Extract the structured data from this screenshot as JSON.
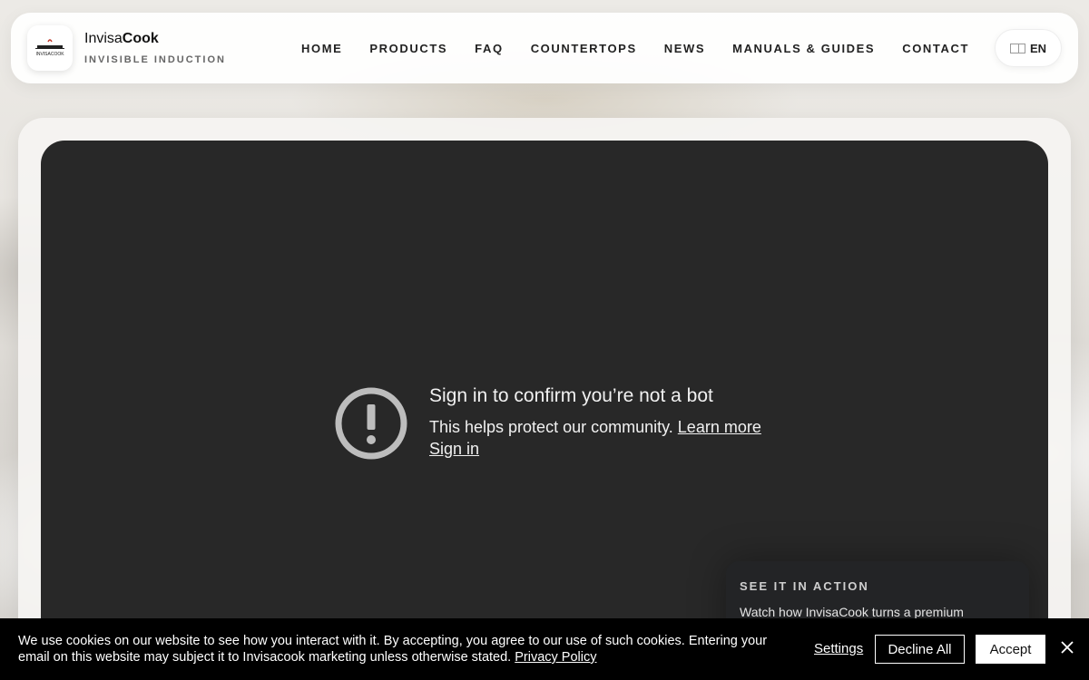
{
  "header": {
    "brand_light": "Invisa",
    "brand_bold": "Cook",
    "tagline": "INVISIBLE INDUCTION",
    "logo_text": "INVISACOOK",
    "nav": [
      {
        "label": "HOME"
      },
      {
        "label": "PRODUCTS"
      },
      {
        "label": "FAQ"
      },
      {
        "label": "COUNTERTOPS"
      },
      {
        "label": "NEWS"
      },
      {
        "label": "MANUALS & GUIDES"
      },
      {
        "label": "CONTACT"
      }
    ],
    "language": "EN",
    "language_icon": "uk-flag-icon"
  },
  "video": {
    "title": "Sign in to confirm you’re not a bot",
    "subtitle": "This helps protect our community.",
    "learn_more": "Learn more",
    "sign_in": "Sign in",
    "icon": "exclamation-circle-icon"
  },
  "action_box": {
    "title": "SEE IT IN ACTION",
    "text": "Watch how InvisaCook turns a premium"
  },
  "cookie": {
    "text": "We use cookies on our website to see how you interact with it. By accepting, you agree to our use of such cookies. Entering your email on this website may subject it to Invisacook marketing unless otherwise stated.",
    "privacy_link": "Privacy Policy",
    "settings": "Settings",
    "decline": "Decline All",
    "accept": "Accept"
  },
  "colors": {
    "video_bg": "#282828",
    "cookie_bg": "#000000",
    "accent_logo": "#c0392b"
  }
}
